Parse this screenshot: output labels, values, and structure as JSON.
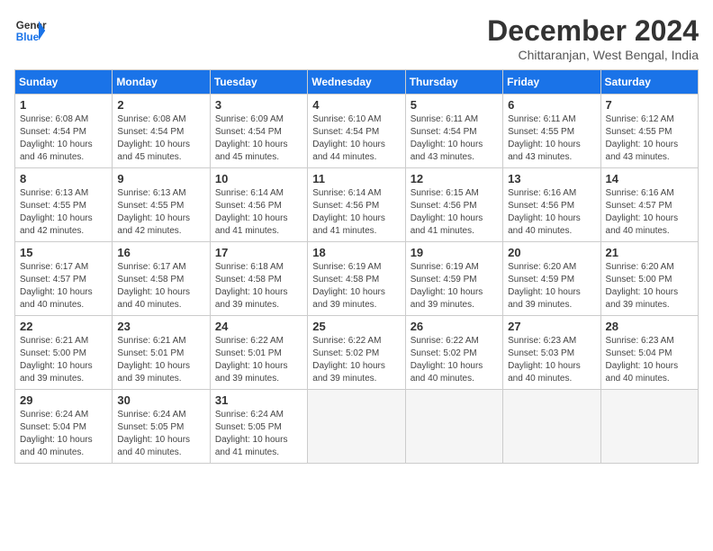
{
  "header": {
    "logo_line1": "General",
    "logo_line2": "Blue",
    "month_title": "December 2024",
    "location": "Chittaranjan, West Bengal, India"
  },
  "weekdays": [
    "Sunday",
    "Monday",
    "Tuesday",
    "Wednesday",
    "Thursday",
    "Friday",
    "Saturday"
  ],
  "weeks": [
    [
      {
        "day": "1",
        "info": "Sunrise: 6:08 AM\nSunset: 4:54 PM\nDaylight: 10 hours\nand 46 minutes."
      },
      {
        "day": "2",
        "info": "Sunrise: 6:08 AM\nSunset: 4:54 PM\nDaylight: 10 hours\nand 45 minutes."
      },
      {
        "day": "3",
        "info": "Sunrise: 6:09 AM\nSunset: 4:54 PM\nDaylight: 10 hours\nand 45 minutes."
      },
      {
        "day": "4",
        "info": "Sunrise: 6:10 AM\nSunset: 4:54 PM\nDaylight: 10 hours\nand 44 minutes."
      },
      {
        "day": "5",
        "info": "Sunrise: 6:11 AM\nSunset: 4:54 PM\nDaylight: 10 hours\nand 43 minutes."
      },
      {
        "day": "6",
        "info": "Sunrise: 6:11 AM\nSunset: 4:55 PM\nDaylight: 10 hours\nand 43 minutes."
      },
      {
        "day": "7",
        "info": "Sunrise: 6:12 AM\nSunset: 4:55 PM\nDaylight: 10 hours\nand 43 minutes."
      }
    ],
    [
      {
        "day": "8",
        "info": "Sunrise: 6:13 AM\nSunset: 4:55 PM\nDaylight: 10 hours\nand 42 minutes."
      },
      {
        "day": "9",
        "info": "Sunrise: 6:13 AM\nSunset: 4:55 PM\nDaylight: 10 hours\nand 42 minutes."
      },
      {
        "day": "10",
        "info": "Sunrise: 6:14 AM\nSunset: 4:56 PM\nDaylight: 10 hours\nand 41 minutes."
      },
      {
        "day": "11",
        "info": "Sunrise: 6:14 AM\nSunset: 4:56 PM\nDaylight: 10 hours\nand 41 minutes."
      },
      {
        "day": "12",
        "info": "Sunrise: 6:15 AM\nSunset: 4:56 PM\nDaylight: 10 hours\nand 41 minutes."
      },
      {
        "day": "13",
        "info": "Sunrise: 6:16 AM\nSunset: 4:56 PM\nDaylight: 10 hours\nand 40 minutes."
      },
      {
        "day": "14",
        "info": "Sunrise: 6:16 AM\nSunset: 4:57 PM\nDaylight: 10 hours\nand 40 minutes."
      }
    ],
    [
      {
        "day": "15",
        "info": "Sunrise: 6:17 AM\nSunset: 4:57 PM\nDaylight: 10 hours\nand 40 minutes."
      },
      {
        "day": "16",
        "info": "Sunrise: 6:17 AM\nSunset: 4:58 PM\nDaylight: 10 hours\nand 40 minutes."
      },
      {
        "day": "17",
        "info": "Sunrise: 6:18 AM\nSunset: 4:58 PM\nDaylight: 10 hours\nand 39 minutes."
      },
      {
        "day": "18",
        "info": "Sunrise: 6:19 AM\nSunset: 4:58 PM\nDaylight: 10 hours\nand 39 minutes."
      },
      {
        "day": "19",
        "info": "Sunrise: 6:19 AM\nSunset: 4:59 PM\nDaylight: 10 hours\nand 39 minutes."
      },
      {
        "day": "20",
        "info": "Sunrise: 6:20 AM\nSunset: 4:59 PM\nDaylight: 10 hours\nand 39 minutes."
      },
      {
        "day": "21",
        "info": "Sunrise: 6:20 AM\nSunset: 5:00 PM\nDaylight: 10 hours\nand 39 minutes."
      }
    ],
    [
      {
        "day": "22",
        "info": "Sunrise: 6:21 AM\nSunset: 5:00 PM\nDaylight: 10 hours\nand 39 minutes."
      },
      {
        "day": "23",
        "info": "Sunrise: 6:21 AM\nSunset: 5:01 PM\nDaylight: 10 hours\nand 39 minutes."
      },
      {
        "day": "24",
        "info": "Sunrise: 6:22 AM\nSunset: 5:01 PM\nDaylight: 10 hours\nand 39 minutes."
      },
      {
        "day": "25",
        "info": "Sunrise: 6:22 AM\nSunset: 5:02 PM\nDaylight: 10 hours\nand 39 minutes."
      },
      {
        "day": "26",
        "info": "Sunrise: 6:22 AM\nSunset: 5:02 PM\nDaylight: 10 hours\nand 40 minutes."
      },
      {
        "day": "27",
        "info": "Sunrise: 6:23 AM\nSunset: 5:03 PM\nDaylight: 10 hours\nand 40 minutes."
      },
      {
        "day": "28",
        "info": "Sunrise: 6:23 AM\nSunset: 5:04 PM\nDaylight: 10 hours\nand 40 minutes."
      }
    ],
    [
      {
        "day": "29",
        "info": "Sunrise: 6:24 AM\nSunset: 5:04 PM\nDaylight: 10 hours\nand 40 minutes."
      },
      {
        "day": "30",
        "info": "Sunrise: 6:24 AM\nSunset: 5:05 PM\nDaylight: 10 hours\nand 40 minutes."
      },
      {
        "day": "31",
        "info": "Sunrise: 6:24 AM\nSunset: 5:05 PM\nDaylight: 10 hours\nand 41 minutes."
      },
      {
        "day": "",
        "info": ""
      },
      {
        "day": "",
        "info": ""
      },
      {
        "day": "",
        "info": ""
      },
      {
        "day": "",
        "info": ""
      }
    ]
  ]
}
